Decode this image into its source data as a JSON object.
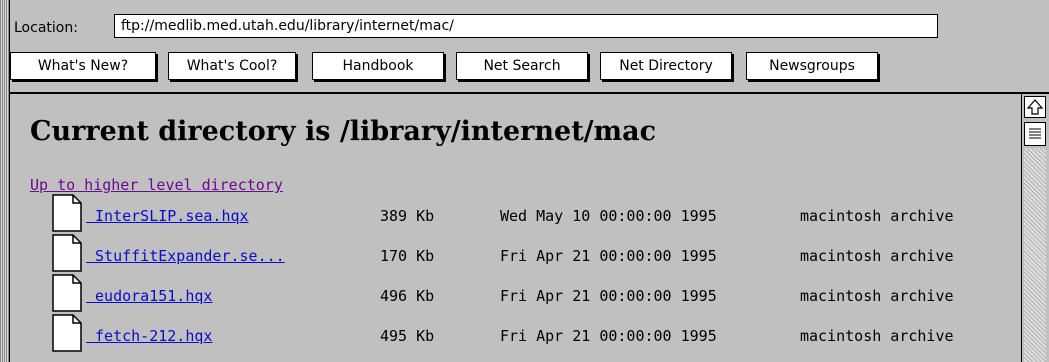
{
  "toolbar": {
    "location_label": "Location:",
    "location_value": "ftp://medlib.med.utah.edu/library/internet/mac/",
    "buttons": [
      "What's New?",
      "What's Cool?",
      "Handbook",
      "Net Search",
      "Net Directory",
      "Newsgroups"
    ]
  },
  "page": {
    "heading": "Current directory is /library/internet/mac",
    "up_link": "Up to higher level directory"
  },
  "files": [
    {
      "name": " InterSLIP.sea.hqx",
      "size": "389 Kb",
      "date": "Wed May 10 00:00:00 1995",
      "type": "macintosh archive"
    },
    {
      "name": " StuffitExpander.se...",
      "size": "170 Kb",
      "date": "Fri Apr 21 00:00:00 1995",
      "type": "macintosh archive"
    },
    {
      "name": " eudora151.hqx",
      "size": "496 Kb",
      "date": "Fri Apr 21 00:00:00 1995",
      "type": "macintosh archive"
    },
    {
      "name": " fetch-212.hqx",
      "size": "495 Kb",
      "date": "Fri Apr 21 00:00:00 1995",
      "type": "macintosh archive"
    }
  ],
  "icons": {
    "file": "document-icon",
    "scroll_up": "up-arrow-icon"
  }
}
